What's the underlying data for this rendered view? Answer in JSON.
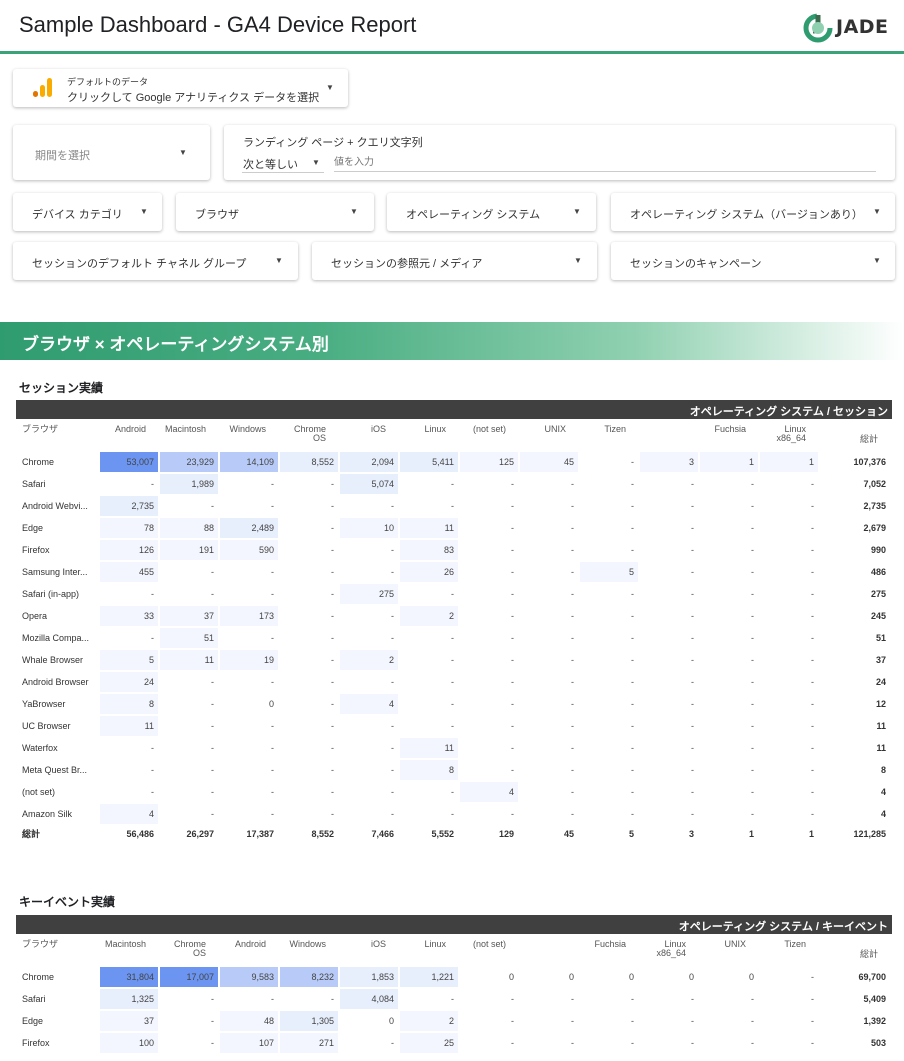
{
  "header": {
    "title": "Sample Dashboard - GA4 Device Report",
    "logo_text": "JADE"
  },
  "colors": {
    "accent": "#3aa37a",
    "heat_strong": "#6b95f0",
    "heat_mid": "#b8cbf8",
    "heat_light": "#e7eefc",
    "heat_faint": "#f3f6fe"
  },
  "controls": {
    "data_source": {
      "top_label": "デフォルトのデータ",
      "label": "クリックして Google アナリティクス データを選択"
    },
    "date_range": {
      "label": "期間を選択"
    },
    "landing": {
      "label": "ランディング ページ + クエリ文字列",
      "operator": "次と等しい",
      "placeholder": "値を入力"
    },
    "device_category": "デバイス カテゴリ",
    "browser": "ブラウザ",
    "os": "オペレーティング システム",
    "os_version": "オペレーティング システム（バージョンあり）",
    "channel_group": "セッションのデフォルト チャネル グループ",
    "source_medium": "セッションの参照元 / メディア",
    "campaign": "セッションのキャンペーン"
  },
  "section_title": "ブラウザ × オペレーティングシステム別",
  "sessions_table": {
    "title": "セッション実績",
    "header": "オペレーティング システム / セッション",
    "row_header": "ブラウザ",
    "columns": [
      "Android",
      "Macintosh",
      "Windows",
      "Chrome OS",
      "iOS",
      "Linux",
      "(not set)",
      "UNIX",
      "Tizen",
      "",
      "Fuchsia",
      "Linux x86_64",
      "総計"
    ],
    "rows": [
      {
        "label": "Chrome",
        "cells": [
          "53,007",
          "23,929",
          "14,109",
          "8,552",
          "2,094",
          "5,411",
          "125",
          "45",
          "-",
          "3",
          "1",
          "1",
          "107,376"
        ]
      },
      {
        "label": "Safari",
        "cells": [
          "-",
          "1,989",
          "-",
          "-",
          "5,074",
          "-",
          "-",
          "-",
          "-",
          "-",
          "-",
          "-",
          "7,052"
        ]
      },
      {
        "label": "Android Webvi...",
        "cells": [
          "2,735",
          "-",
          "-",
          "-",
          "-",
          "-",
          "-",
          "-",
          "-",
          "-",
          "-",
          "-",
          "2,735"
        ]
      },
      {
        "label": "Edge",
        "cells": [
          "78",
          "88",
          "2,489",
          "-",
          "10",
          "11",
          "-",
          "-",
          "-",
          "-",
          "-",
          "-",
          "2,679"
        ]
      },
      {
        "label": "Firefox",
        "cells": [
          "126",
          "191",
          "590",
          "-",
          "-",
          "83",
          "-",
          "-",
          "-",
          "-",
          "-",
          "-",
          "990"
        ]
      },
      {
        "label": "Samsung Inter...",
        "cells": [
          "455",
          "-",
          "-",
          "-",
          "-",
          "26",
          "-",
          "-",
          "5",
          "-",
          "-",
          "-",
          "486"
        ]
      },
      {
        "label": "Safari (in-app)",
        "cells": [
          "-",
          "-",
          "-",
          "-",
          "275",
          "-",
          "-",
          "-",
          "-",
          "-",
          "-",
          "-",
          "275"
        ]
      },
      {
        "label": "Opera",
        "cells": [
          "33",
          "37",
          "173",
          "-",
          "-",
          "2",
          "-",
          "-",
          "-",
          "-",
          "-",
          "-",
          "245"
        ]
      },
      {
        "label": "Mozilla Compa...",
        "cells": [
          "-",
          "51",
          "-",
          "-",
          "-",
          "-",
          "-",
          "-",
          "-",
          "-",
          "-",
          "-",
          "51"
        ]
      },
      {
        "label": "Whale Browser",
        "cells": [
          "5",
          "11",
          "19",
          "-",
          "2",
          "-",
          "-",
          "-",
          "-",
          "-",
          "-",
          "-",
          "37"
        ]
      },
      {
        "label": "Android Browser",
        "cells": [
          "24",
          "-",
          "-",
          "-",
          "-",
          "-",
          "-",
          "-",
          "-",
          "-",
          "-",
          "-",
          "24"
        ]
      },
      {
        "label": "YaBrowser",
        "cells": [
          "8",
          "-",
          "0",
          "-",
          "4",
          "-",
          "-",
          "-",
          "-",
          "-",
          "-",
          "-",
          "12"
        ]
      },
      {
        "label": "UC Browser",
        "cells": [
          "11",
          "-",
          "-",
          "-",
          "-",
          "-",
          "-",
          "-",
          "-",
          "-",
          "-",
          "-",
          "11"
        ]
      },
      {
        "label": "Waterfox",
        "cells": [
          "-",
          "-",
          "-",
          "-",
          "-",
          "11",
          "-",
          "-",
          "-",
          "-",
          "-",
          "-",
          "11"
        ]
      },
      {
        "label": "Meta Quest Br...",
        "cells": [
          "-",
          "-",
          "-",
          "-",
          "-",
          "8",
          "-",
          "-",
          "-",
          "-",
          "-",
          "-",
          "8"
        ]
      },
      {
        "label": "(not set)",
        "cells": [
          "-",
          "-",
          "-",
          "-",
          "-",
          "-",
          "4",
          "-",
          "-",
          "-",
          "-",
          "-",
          "4"
        ]
      },
      {
        "label": "Amazon Silk",
        "cells": [
          "4",
          "-",
          "-",
          "-",
          "-",
          "-",
          "-",
          "-",
          "-",
          "-",
          "-",
          "-",
          "4"
        ]
      }
    ],
    "total_label": "総計",
    "totals": [
      "56,486",
      "26,297",
      "17,387",
      "8,552",
      "7,466",
      "5,552",
      "129",
      "45",
      "5",
      "3",
      "1",
      "1",
      "121,285"
    ]
  },
  "events_table": {
    "title": "キーイベント実績",
    "header": "オペレーティング システム / キーイベント",
    "row_header": "ブラウザ",
    "columns": [
      "Macintosh",
      "Chrome OS",
      "Android",
      "Windows",
      "iOS",
      "Linux",
      "(not set)",
      "",
      "Fuchsia",
      "Linux x86_64",
      "UNIX",
      "Tizen",
      "総計"
    ],
    "rows": [
      {
        "label": "Chrome",
        "cells": [
          "31,804",
          "17,007",
          "9,583",
          "8,232",
          "1,853",
          "1,221",
          "0",
          "0",
          "0",
          "0",
          "0",
          "-",
          "69,700"
        ]
      },
      {
        "label": "Safari",
        "cells": [
          "1,325",
          "-",
          "-",
          "-",
          "4,084",
          "-",
          "-",
          "-",
          "-",
          "-",
          "-",
          "-",
          "5,409"
        ]
      },
      {
        "label": "Edge",
        "cells": [
          "37",
          "-",
          "48",
          "1,305",
          "0",
          "2",
          "-",
          "-",
          "-",
          "-",
          "-",
          "-",
          "1,392"
        ]
      },
      {
        "label": "Firefox",
        "cells": [
          "100",
          "-",
          "107",
          "271",
          "-",
          "25",
          "-",
          "-",
          "-",
          "-",
          "-",
          "-",
          "503"
        ]
      }
    ]
  }
}
